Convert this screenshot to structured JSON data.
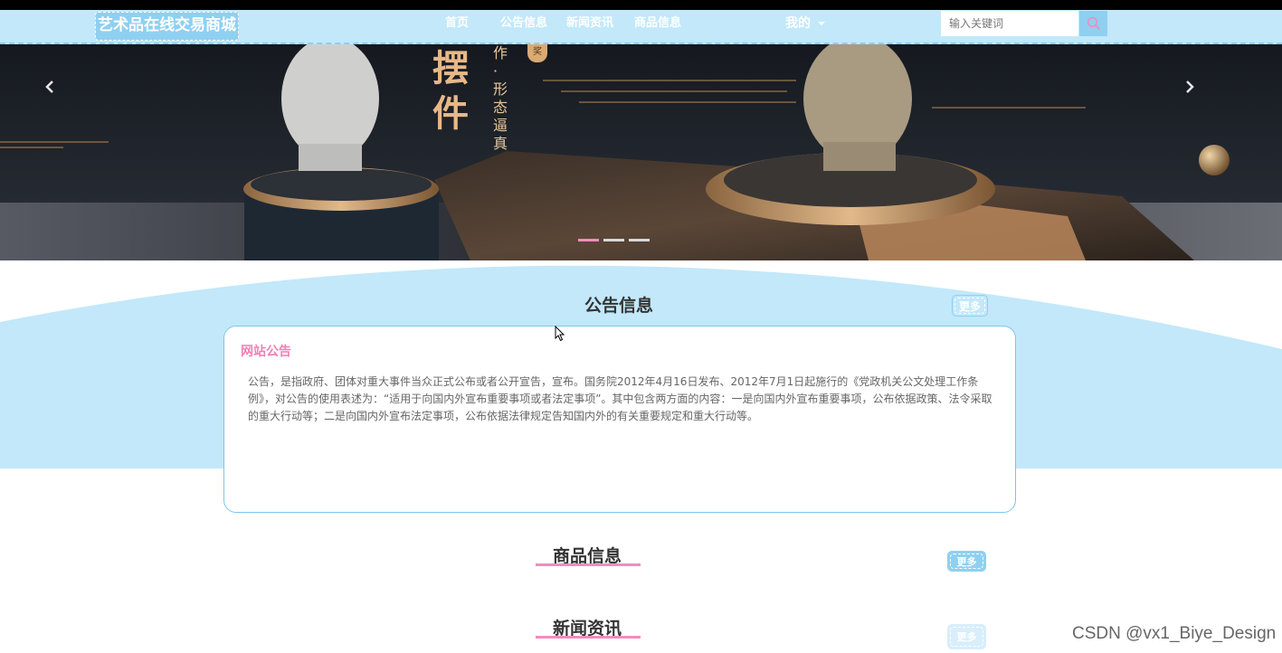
{
  "brand": {
    "title": "艺术品在线交易商城"
  },
  "nav": {
    "items": [
      {
        "label": "首页"
      },
      {
        "label": "公告信息"
      },
      {
        "label": "新闻资讯"
      },
      {
        "label": "商品信息"
      }
    ],
    "mine_label": "我的"
  },
  "search": {
    "placeholder": "输入关键词"
  },
  "banner": {
    "calligraphy_main": "摆件",
    "calligraphy_side": "作·形态逼真",
    "badge": "奖",
    "slides_total": 3,
    "active_slide": 1
  },
  "notice": {
    "title": "公告信息",
    "more_label": "更多",
    "card_label": "网站公告",
    "content": "公告，是指政府、团体对重大事件当众正式公布或者公开宣告，宣布。国务院2012年4月16日发布、2012年7月1日起施行的《党政机关公文处理工作条例》，对公告的使用表述为：“适用于向国内外宣布重要事项或者法定事项”。其中包含两方面的内容：一是向国内外宣布重要事项，公布依据政策、法令采取的重大行动等；二是向国内外宣布法定事项，公布依据法律规定告知国内外的有关重要规定和重大行动等。"
  },
  "products": {
    "title": "商品信息",
    "more_label": "更多"
  },
  "news": {
    "title": "新闻资讯",
    "more_label": "更多"
  },
  "watermark": "CSDN @vx1_Biye_Design",
  "colors": {
    "nav_bg": "#c2e8fa",
    "accent_pink": "#f08dbe",
    "accent_blue": "#8fd0f1"
  }
}
